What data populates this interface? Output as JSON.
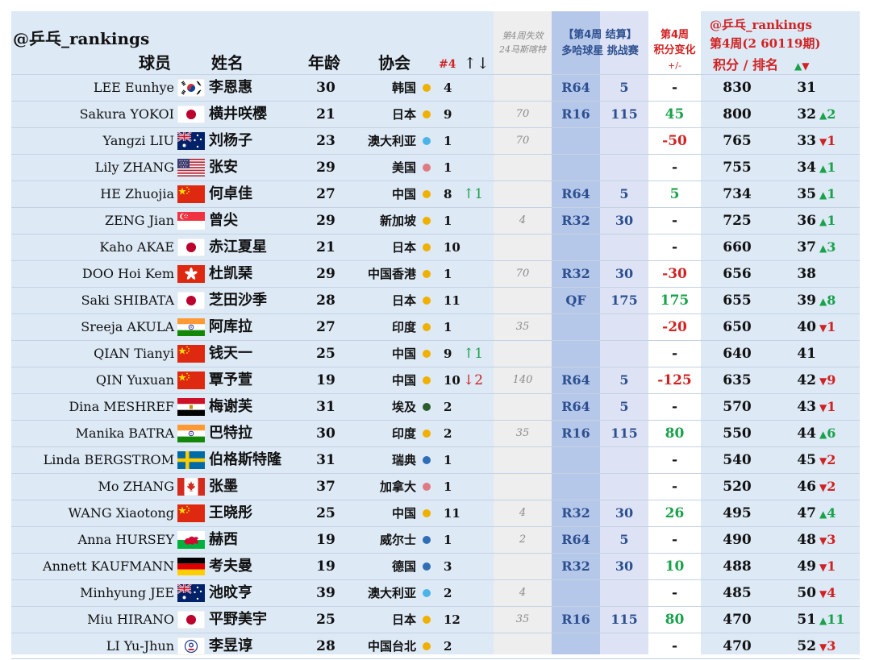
{
  "header": {
    "brand": "@乒乓_rankings",
    "col_player": "球员",
    "col_name": "姓名",
    "col_age": "年龄",
    "col_assoc": "协会",
    "col_week4_count": "#4",
    "col_week4_arrows": "↑↓",
    "loss_line1": "第4周失效",
    "loss_line2": "24马斯喀特",
    "result_line1": "【第4周 结算】",
    "result_line2": "多哈球星 挑战赛",
    "change_line1": "第4周",
    "change_line2": "积分变化",
    "change_line3": "+/-",
    "total_line1": "@乒乓_rankings",
    "total_line2": "第4周(2 60119期)",
    "total_line3": "积分 / 排名",
    "up_symbol": "▲",
    "down_symbol": "▼"
  },
  "colors": {
    "dot_yellow": "#f0b000",
    "dot_lightblue": "#4ab4e8",
    "dot_pink": "#e07a82",
    "dot_darkblue": "#2f6db5",
    "dot_darkgreen": "#2b5d2b",
    "positive": "#19a24a",
    "negative": "#d12222",
    "result_blue": "#2c4f8f"
  },
  "rows": [
    {
      "en": "LEE Eunhye",
      "flag": "korea-flag-icon",
      "cn": "李恩惠",
      "age": "30",
      "assoc": "韩国",
      "dot": "dot_yellow",
      "n4": "4",
      "move": "",
      "move_dir": "",
      "loss": "",
      "result": "R64",
      "points": "5",
      "change": "-",
      "change_type": "neutral",
      "total": "830",
      "rank": "31",
      "rank_change": "",
      "rank_dir": ""
    },
    {
      "en": "Sakura YOKOI",
      "flag": "japan-flag-icon",
      "cn": "横井咲樱",
      "age": "21",
      "assoc": "日本",
      "dot": "dot_yellow",
      "n4": "9",
      "move": "",
      "move_dir": "",
      "loss": "70",
      "result": "R16",
      "points": "115",
      "change": "45",
      "change_type": "pos",
      "total": "800",
      "rank": "32",
      "rank_change": "2",
      "rank_dir": "up"
    },
    {
      "en": "Yangzi LIU",
      "flag": "australia-flag-icon",
      "cn": "刘杨子",
      "age": "23",
      "assoc": "澳大利亚",
      "dot": "dot_lightblue",
      "n4": "1",
      "move": "",
      "move_dir": "",
      "loss": "70",
      "result": "",
      "points": "",
      "change": "-50",
      "change_type": "neg",
      "total": "765",
      "rank": "33",
      "rank_change": "1",
      "rank_dir": "dn"
    },
    {
      "en": "Lily ZHANG",
      "flag": "usa-flag-icon",
      "cn": "张安",
      "age": "29",
      "assoc": "美国",
      "dot": "dot_pink",
      "n4": "1",
      "move": "",
      "move_dir": "",
      "loss": "",
      "result": "",
      "points": "",
      "change": "-",
      "change_type": "neutral",
      "total": "755",
      "rank": "34",
      "rank_change": "1",
      "rank_dir": "up"
    },
    {
      "en": "HE Zhuojia",
      "flag": "china-flag-icon",
      "cn": "何卓佳",
      "age": "27",
      "assoc": "中国",
      "dot": "dot_yellow",
      "n4": "8",
      "move": "↑1",
      "move_dir": "up",
      "loss": "",
      "result": "R64",
      "points": "5",
      "change": "5",
      "change_type": "pos",
      "total": "734",
      "rank": "35",
      "rank_change": "1",
      "rank_dir": "up"
    },
    {
      "en": "ZENG Jian",
      "flag": "singapore-flag-icon",
      "cn": "曾尖",
      "age": "29",
      "assoc": "新加坡",
      "dot": "dot_yellow",
      "n4": "1",
      "move": "",
      "move_dir": "",
      "loss": "4",
      "result": "R32",
      "points": "30",
      "change": "-",
      "change_type": "neutral",
      "total": "725",
      "rank": "36",
      "rank_change": "1",
      "rank_dir": "up"
    },
    {
      "en": "Kaho AKAE",
      "flag": "japan-flag-icon",
      "cn": "赤江夏星",
      "age": "21",
      "assoc": "日本",
      "dot": "dot_yellow",
      "n4": "10",
      "move": "",
      "move_dir": "",
      "loss": "",
      "result": "",
      "points": "",
      "change": "-",
      "change_type": "neutral",
      "total": "660",
      "rank": "37",
      "rank_change": "3",
      "rank_dir": "up"
    },
    {
      "en": "DOO Hoi Kem",
      "flag": "hongkong-flag-icon",
      "cn": "杜凯琹",
      "age": "29",
      "assoc": "中国香港",
      "dot": "dot_yellow",
      "n4": "1",
      "move": "",
      "move_dir": "",
      "loss": "70",
      "result": "R32",
      "points": "30",
      "change": "-30",
      "change_type": "neg",
      "total": "656",
      "rank": "38",
      "rank_change": "",
      "rank_dir": ""
    },
    {
      "en": "Saki SHIBATA",
      "flag": "japan-flag-icon",
      "cn": "芝田沙季",
      "age": "28",
      "assoc": "日本",
      "dot": "dot_yellow",
      "n4": "11",
      "move": "",
      "move_dir": "",
      "loss": "",
      "result": "QF",
      "points": "175",
      "change": "175",
      "change_type": "pos",
      "total": "655",
      "rank": "39",
      "rank_change": "8",
      "rank_dir": "up"
    },
    {
      "en": "Sreeja AKULA",
      "flag": "india-flag-icon",
      "cn": "阿库拉",
      "age": "27",
      "assoc": "印度",
      "dot": "dot_yellow",
      "n4": "1",
      "move": "",
      "move_dir": "",
      "loss": "35",
      "result": "",
      "points": "",
      "change": "-20",
      "change_type": "neg",
      "total": "650",
      "rank": "40",
      "rank_change": "1",
      "rank_dir": "dn"
    },
    {
      "en": "QIAN Tianyi",
      "flag": "china-flag-icon",
      "cn": "钱天一",
      "age": "25",
      "assoc": "中国",
      "dot": "dot_yellow",
      "n4": "9",
      "move": "↑1",
      "move_dir": "up",
      "loss": "",
      "result": "",
      "points": "",
      "change": "-",
      "change_type": "neutral",
      "total": "640",
      "rank": "41",
      "rank_change": "",
      "rank_dir": ""
    },
    {
      "en": "QIN Yuxuan",
      "flag": "china-flag-icon",
      "cn": "覃予萱",
      "age": "19",
      "assoc": "中国",
      "dot": "dot_yellow",
      "n4": "10",
      "move": "↓2",
      "move_dir": "dn",
      "loss": "140",
      "result": "R64",
      "points": "5",
      "change": "-125",
      "change_type": "neg",
      "total": "635",
      "rank": "42",
      "rank_change": "9",
      "rank_dir": "dn"
    },
    {
      "en": "Dina MESHREF",
      "flag": "egypt-flag-icon",
      "cn": "梅谢芙",
      "age": "31",
      "assoc": "埃及",
      "dot": "dot_darkgreen",
      "n4": "2",
      "move": "",
      "move_dir": "",
      "loss": "",
      "result": "R64",
      "points": "5",
      "change": "-",
      "change_type": "neutral",
      "total": "570",
      "rank": "43",
      "rank_change": "1",
      "rank_dir": "dn"
    },
    {
      "en": "Manika BATRA",
      "flag": "india-flag-icon",
      "cn": "巴特拉",
      "age": "30",
      "assoc": "印度",
      "dot": "dot_yellow",
      "n4": "2",
      "move": "",
      "move_dir": "",
      "loss": "35",
      "result": "R16",
      "points": "115",
      "change": "80",
      "change_type": "pos",
      "total": "550",
      "rank": "44",
      "rank_change": "6",
      "rank_dir": "up"
    },
    {
      "en": "Linda BERGSTROM",
      "flag": "sweden-flag-icon",
      "cn": "伯格斯特隆",
      "age": "31",
      "assoc": "瑞典",
      "dot": "dot_darkblue",
      "n4": "1",
      "move": "",
      "move_dir": "",
      "loss": "",
      "result": "",
      "points": "",
      "change": "-",
      "change_type": "neutral",
      "total": "540",
      "rank": "45",
      "rank_change": "2",
      "rank_dir": "dn"
    },
    {
      "en": "Mo ZHANG",
      "flag": "canada-flag-icon",
      "cn": "张墨",
      "age": "37",
      "assoc": "加拿大",
      "dot": "dot_pink",
      "n4": "1",
      "move": "",
      "move_dir": "",
      "loss": "",
      "result": "",
      "points": "",
      "change": "-",
      "change_type": "neutral",
      "total": "520",
      "rank": "46",
      "rank_change": "2",
      "rank_dir": "dn"
    },
    {
      "en": "WANG Xiaotong",
      "flag": "china-flag-icon",
      "cn": "王晓彤",
      "age": "25",
      "assoc": "中国",
      "dot": "dot_yellow",
      "n4": "11",
      "move": "",
      "move_dir": "",
      "loss": "4",
      "result": "R32",
      "points": "30",
      "change": "26",
      "change_type": "pos",
      "total": "495",
      "rank": "47",
      "rank_change": "4",
      "rank_dir": "up"
    },
    {
      "en": "Anna HURSEY",
      "flag": "wales-flag-icon",
      "cn": "赫西",
      "age": "19",
      "assoc": "威尔士",
      "dot": "dot_darkblue",
      "n4": "1",
      "move": "",
      "move_dir": "",
      "loss": "2",
      "result": "R64",
      "points": "5",
      "change": "-",
      "change_type": "neutral",
      "total": "490",
      "rank": "48",
      "rank_change": "3",
      "rank_dir": "dn"
    },
    {
      "en": "Annett KAUFMANN",
      "flag": "germany-flag-icon",
      "cn": "考夫曼",
      "age": "19",
      "assoc": "德国",
      "dot": "dot_darkblue",
      "n4": "3",
      "move": "",
      "move_dir": "",
      "loss": "",
      "result": "R32",
      "points": "30",
      "change": "10",
      "change_type": "pos",
      "total": "488",
      "rank": "49",
      "rank_change": "1",
      "rank_dir": "dn"
    },
    {
      "en": "Minhyung JEE",
      "flag": "australia-flag-icon",
      "cn": "池旼亨",
      "age": "39",
      "assoc": "澳大利亚",
      "dot": "dot_lightblue",
      "n4": "2",
      "move": "",
      "move_dir": "",
      "loss": "4",
      "result": "",
      "points": "",
      "change": "-",
      "change_type": "neutral",
      "total": "485",
      "rank": "50",
      "rank_change": "4",
      "rank_dir": "dn"
    },
    {
      "en": "Miu HIRANO",
      "flag": "japan-flag-icon",
      "cn": "平野美宇",
      "age": "25",
      "assoc": "日本",
      "dot": "dot_yellow",
      "n4": "12",
      "move": "",
      "move_dir": "",
      "loss": "35",
      "result": "R16",
      "points": "115",
      "change": "80",
      "change_type": "pos",
      "total": "470",
      "rank": "51",
      "rank_change": "11",
      "rank_dir": "up"
    },
    {
      "en": "LI Yu-Jhun",
      "flag": "chinese-taipei-flag-icon",
      "cn": "李昱谆",
      "age": "28",
      "assoc": "中国台北",
      "dot": "dot_yellow",
      "n4": "2",
      "move": "",
      "move_dir": "",
      "loss": "",
      "result": "",
      "points": "",
      "change": "-",
      "change_type": "neutral",
      "total": "470",
      "rank": "52",
      "rank_change": "3",
      "rank_dir": "dn"
    }
  ]
}
